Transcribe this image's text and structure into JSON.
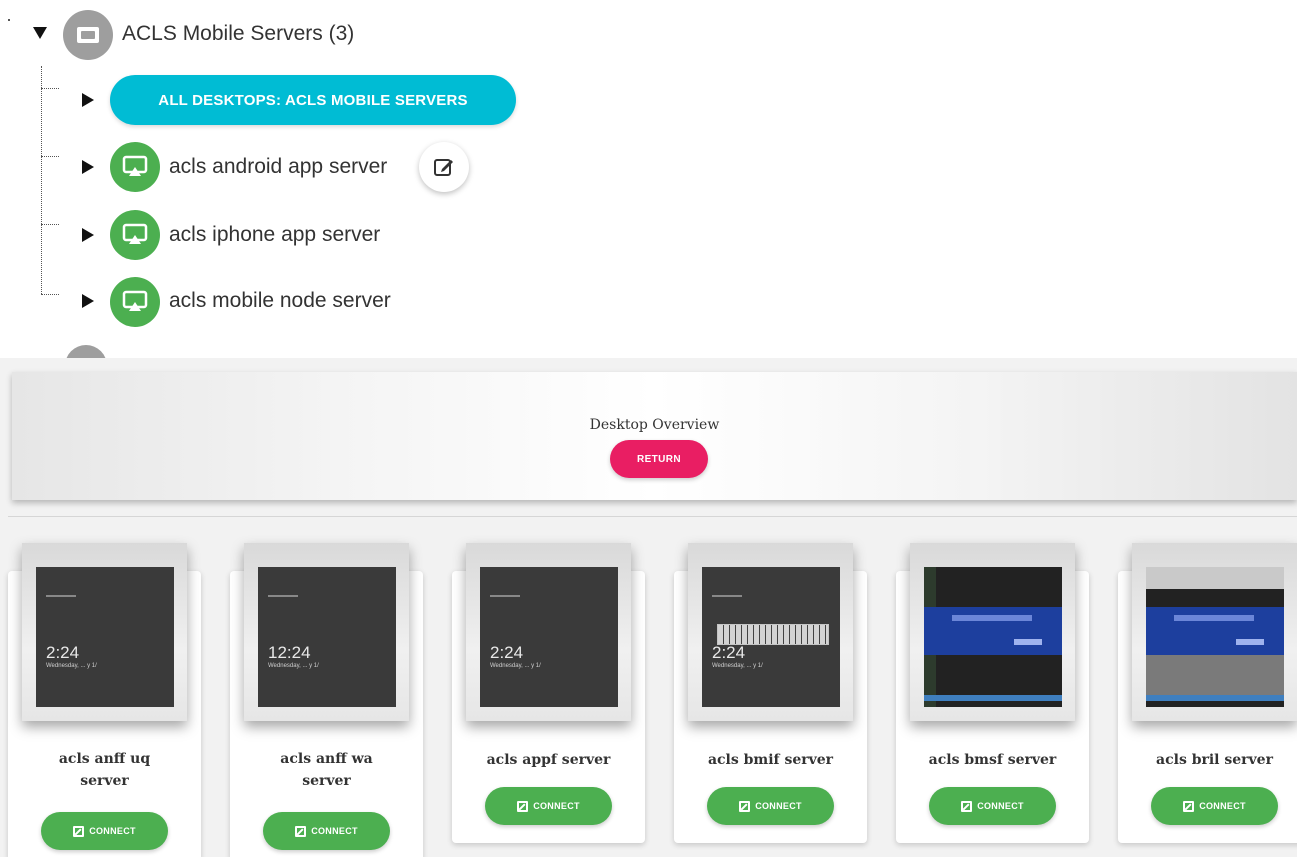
{
  "tree": {
    "root": {
      "label": "ACLS Mobile Servers (3)",
      "icon": "folder-icon",
      "caret": "expanded"
    },
    "pill": {
      "label": "ALL DESKTOPS: ACLS MOBILE SERVERS",
      "color": "#00bcd4"
    },
    "items": [
      {
        "label": "acls android app server",
        "icon": "desktop-icon",
        "editable": true
      },
      {
        "label": "acls iphone app server",
        "icon": "desktop-icon"
      },
      {
        "label": "acls mobile node server",
        "icon": "desktop-icon"
      }
    ],
    "colors": {
      "desktop": "#4caf50",
      "folder": "#9e9e9e"
    }
  },
  "overview": {
    "title": "Desktop Overview",
    "return_label": "RETURN",
    "return_color": "#e91e63",
    "connect_color": "#4caf50",
    "cards": [
      {
        "line1": "acls anff uq",
        "line2": "server",
        "time": "2:24",
        "date": "Wednesday, ... y 1/",
        "screen": "lock",
        "connect": "CONNECT"
      },
      {
        "line1": "acls anff wa",
        "line2": "server",
        "time": "12:24",
        "date": "Wednesday, ... y 1/",
        "screen": "lock",
        "connect": "CONNECT"
      },
      {
        "line1": "acls appf server",
        "line2": "",
        "time": "2:24",
        "date": "Wednesday, ... y 1/",
        "screen": "lock",
        "connect": "CONNECT"
      },
      {
        "line1": "acls bmif server",
        "line2": "",
        "time": "2:24",
        "date": "Wednesday, ... y 1/",
        "screen": "lock-keyboard",
        "connect": "CONNECT"
      },
      {
        "line1": "acls bmsf server",
        "line2": "",
        "time": "",
        "date": "",
        "screen": "desktop-dialog",
        "connect": "CONNECT"
      },
      {
        "line1": "acls bril server",
        "line2": "",
        "time": "",
        "date": "",
        "screen": "browser-dialog",
        "connect": "CONNECT"
      }
    ]
  }
}
